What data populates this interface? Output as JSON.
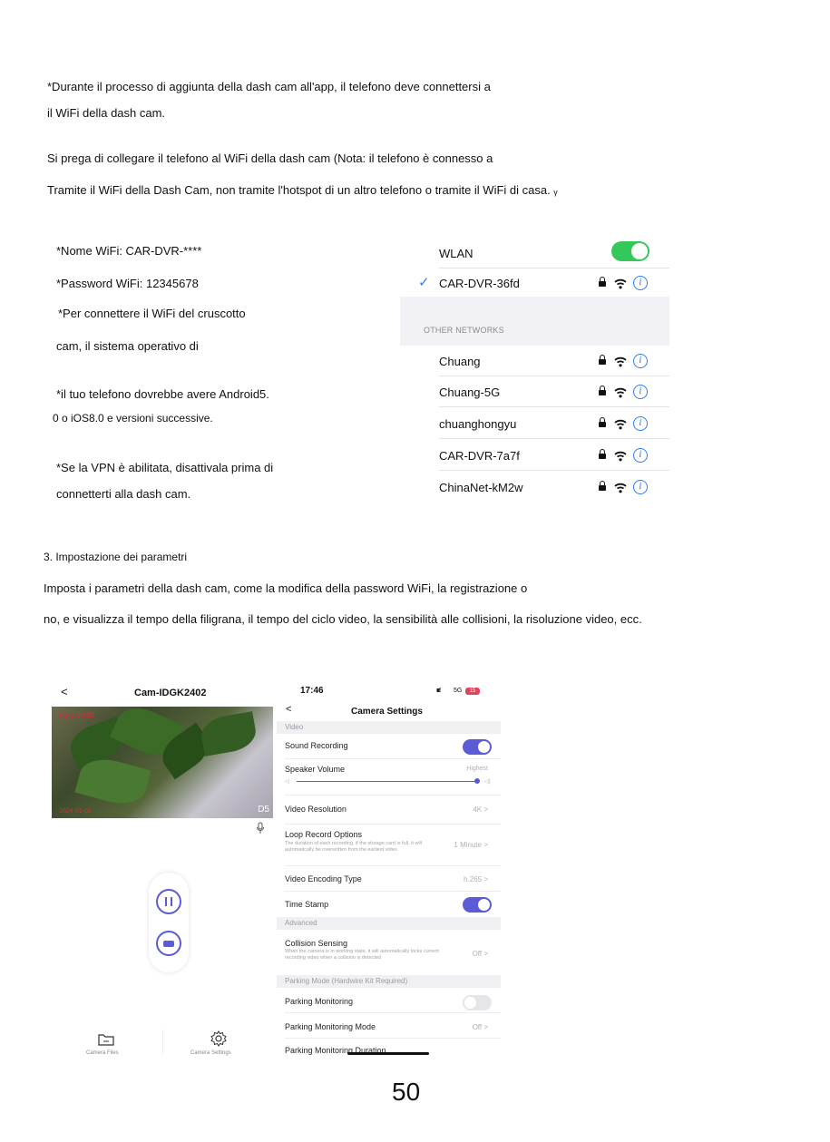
{
  "intro": {
    "line1": "*Durante il processo di aggiunta della dash cam all'app, il telefono deve connettersi a",
    "line2": "il WiFi della dash cam.",
    "line3": "Si prega di collegare il telefono al WiFi della dash cam (Nota: il telefono è connesso a",
    "line4": "Tramite il WiFi della Dash Cam, non tramite l'hotspot di un altro telefono o tramite il WiFi di casa. ᵧ"
  },
  "wifi_info": {
    "name": "*Nome WiFi: CAR-DVR-****",
    "password": "*Password WiFi: 12345678",
    "note1a": "*Per connettere il WiFi del cruscotto",
    "note1b": "cam, il sistema operativo di",
    "note2a": "*il tuo telefono dovrebbe avere Android5.",
    "note2b": "0 o iOS8.0 e versioni successive.",
    "note3a": "*Se la VPN è abilitata, disattivala prima di",
    "note3b": "connetterti alla dash cam."
  },
  "wlan": {
    "title": "WLAN",
    "connected": "CAR-DVR-36fd",
    "other_header": "OTHER NETWORKS",
    "networks": [
      "Chuang",
      "Chuang-5G",
      "chuanghongyu",
      "CAR-DVR-7a7f",
      "ChinaNet-kM2w"
    ],
    "toggle_color": "#34c759",
    "accent_color": "#2f7bf6"
  },
  "section3": {
    "heading": "3. Impostazione dei parametri",
    "body1": "Imposta i parametri della dash cam, come la modifica della password WiFi, la registrazione o",
    "body2": "no, e visualizza il tempo della filigrana, il tempo del ciclo video, la sensibilità alle collisioni, la risoluzione video, ecc."
  },
  "app_left": {
    "back": "<",
    "title": "Cam-IDGK2402",
    "overlay_top": "REC 00:00",
    "overlay_bottom": "2024-01-01",
    "corner": "D5",
    "tab_files": "Camera Files",
    "tab_settings": "Camera Settings"
  },
  "settings": {
    "time": "17:46",
    "status": "5G",
    "battery": "15",
    "back": "<",
    "title": "Camera Settings",
    "sec_video": "Video",
    "sound_recording": "Sound Recording",
    "speaker_volume": "Speaker Volume",
    "speaker_value": "Highest",
    "video_resolution": "Video Resolution",
    "video_resolution_value": "4K >",
    "loop_record": "Loop Record Options",
    "loop_record_sub": "The duration of each recording, if the storage card is full, it will automatically be overwritten from the earliest video",
    "loop_record_value": "1 Minute >",
    "video_encoding": "Video Encoding Type",
    "video_encoding_value": "h.265 >",
    "time_stamp": "Time Stamp",
    "sec_advanced": "Advanced",
    "collision": "Collision Sensing",
    "collision_sub": "When the camera is in working state, it will automatically locks current recording video when a collision is detected",
    "collision_value": "Off >",
    "sec_parking": "Parking Mode (Hardwire Kit Required)",
    "parking_monitoring": "Parking Monitoring",
    "parking_mode": "Parking Monitoring Mode",
    "parking_mode_value": "Off >",
    "parking_duration": "Parking Monitoring Duration",
    "accent_color": "#5b5bd6"
  },
  "page_number": "50"
}
